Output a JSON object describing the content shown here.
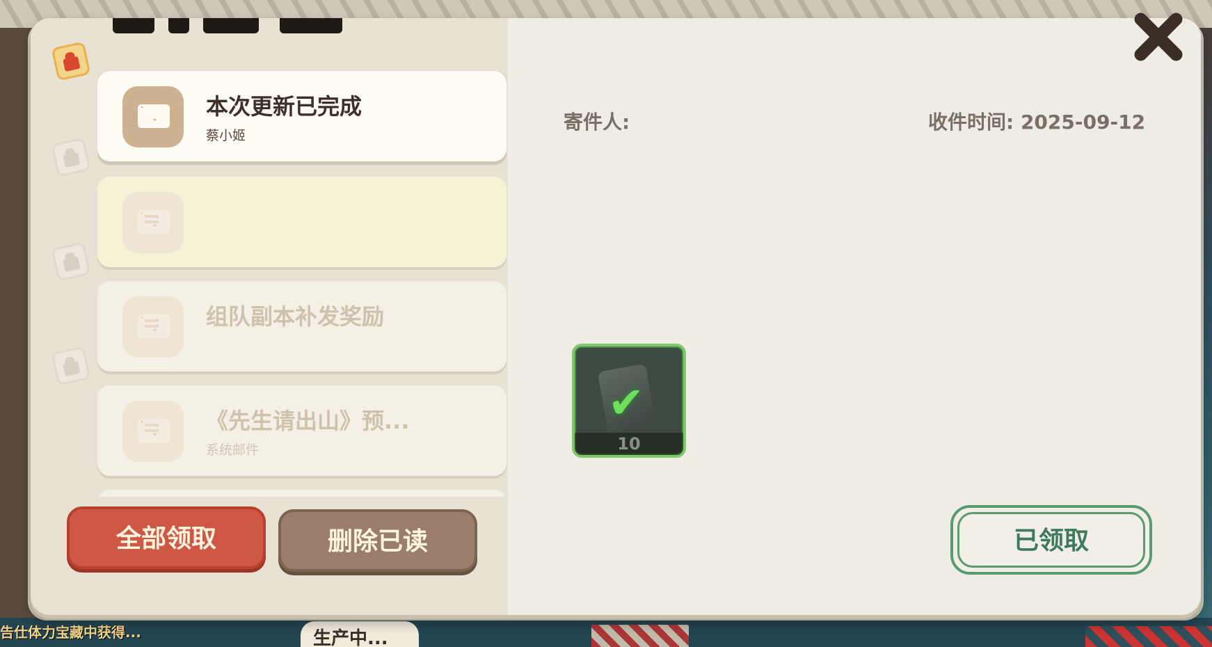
{
  "background": {
    "ticker_text": "告仕体力宝藏中获得...",
    "status_text": "生产中..."
  },
  "mail_list": [
    {
      "title": "本次更新已完成",
      "sender": "蔡小姬",
      "state": "active",
      "has_gift": true
    },
    {
      "title": "",
      "sender": "",
      "state": "highlight",
      "has_gift": true
    },
    {
      "title": "组队副本补发奖励",
      "sender": "",
      "state": "faded",
      "has_gift": true
    },
    {
      "title": "《先生请出山》预...",
      "sender": "系统邮件",
      "state": "faded",
      "has_gift": true
    }
  ],
  "buttons": {
    "claim_all": "全部领取",
    "delete_read": "删除已读",
    "claimed": "已领取"
  },
  "detail": {
    "sender_label": "寄件人:",
    "received_time": "收件时间: 2025-09-12",
    "reward": {
      "icon": "scroll-icon",
      "count": "10",
      "claimed": true
    }
  },
  "colors": {
    "claim_all": "#cf5746",
    "delete_read": "#9b7d6b",
    "claimed_border": "#5a9a72",
    "reward_border": "#7ec86b"
  }
}
